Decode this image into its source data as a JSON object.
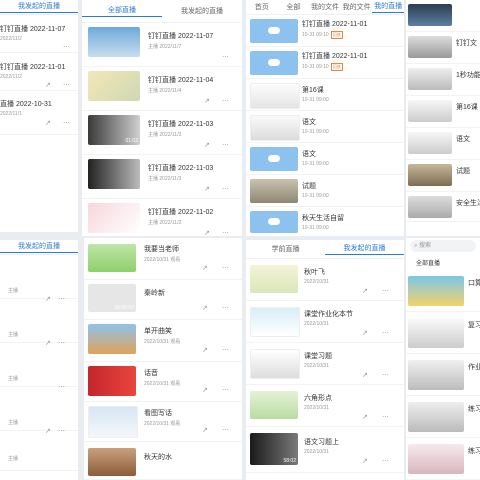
{
  "p1": {
    "tabs": [
      "我发起的直播"
    ],
    "items": [
      {
        "title": "钉钉直播 2022-11-07",
        "date": "2022/11/2"
      },
      {
        "title": "钉钉直播 2022-11-01",
        "date": "2022/11/2"
      },
      {
        "title": "直播 2022-10-31",
        "date": "2022/11/1"
      }
    ],
    "tabs2": [
      "我发起的直播"
    ],
    "items2": [
      {
        "sub": "主播"
      },
      {
        "sub": "主播"
      },
      {
        "sub": "主播"
      },
      {
        "sub": "主播"
      },
      {
        "sub": "主播"
      }
    ]
  },
  "p2": {
    "tabs": [
      "全部直播",
      "我发起的直播"
    ],
    "items": [
      {
        "title": "钉钉直播 2022-11-07",
        "sub": "主播  2022/11/7"
      },
      {
        "title": "钉钉直播 2022-11-04",
        "sub": "主播  2022/11/4"
      },
      {
        "title": "钉钉直播 2022-11-03",
        "sub": "主播  2022/11/3",
        "dur": "01:02"
      },
      {
        "title": "钉钉直播 2022-11-03",
        "sub": "主播  2022/11/3"
      },
      {
        "title": "钉钉直播 2022-11-02",
        "sub": "主播  2022/11/2"
      }
    ],
    "items2": [
      {
        "title": "我要当老师",
        "sub": "2022/10/31  观看"
      },
      {
        "title": "秦岭新",
        "sub": "",
        "dur": "05:00:02"
      },
      {
        "title": "单开曲笑",
        "sub": "2022/10/31  观看"
      },
      {
        "title": "话音",
        "sub": "2022/10/31  观看"
      },
      {
        "title": "看图写话",
        "sub": "2022/10/31  观看"
      },
      {
        "title": "秋天的水",
        "sub": ""
      }
    ]
  },
  "p3": {
    "tabs": [
      "首页",
      "全部",
      "我的文件",
      "我的文件",
      "我的直播"
    ],
    "items": [
      {
        "title": "钉钉直播 2022-11-01",
        "sub": "10-31 09:10",
        "tag": "回放"
      },
      {
        "title": "钉钉直播 2022-11-01",
        "sub": "10-31 09:10",
        "tag": "回放"
      },
      {
        "title": "第16课",
        "sub": "10-31 09:00"
      },
      {
        "title": "语文",
        "sub": "10-31 09:00"
      },
      {
        "title": "语文",
        "sub": "10-31 09:00"
      },
      {
        "title": "试题",
        "sub": "10-31 09:00"
      },
      {
        "title": "秋天生活自留",
        "sub": "10-31 09:00"
      }
    ],
    "tabs2": [
      "学前直播",
      "我发起的直播"
    ],
    "items2": [
      {
        "title": "秋叶飞",
        "sub": "2022/10/31"
      },
      {
        "title": "课堂作业化本节",
        "sub": "2022/10/31"
      },
      {
        "title": "课堂习题",
        "sub": "2022/10/31"
      },
      {
        "title": "六角形点",
        "sub": "2022/10/31"
      },
      {
        "title": "语文习题上",
        "sub": "2022/10/31",
        "dur": "58:02"
      }
    ]
  },
  "p4": {
    "items": [
      {
        "title": ""
      },
      {
        "title": "钉钉文",
        "sub": ""
      },
      {
        "title": "1秒功能",
        "sub": ""
      },
      {
        "title": "第16课",
        "sub": ""
      },
      {
        "title": "语文",
        "sub": ""
      },
      {
        "title": "试题",
        "sub": ""
      },
      {
        "title": "安全生活",
        "sub": ""
      }
    ],
    "search": "搜索",
    "tab": "全部直播",
    "items2": [
      {
        "title": "口算",
        "sub": ""
      },
      {
        "title": "复习",
        "sub": ""
      },
      {
        "title": "作业",
        "sub": ""
      },
      {
        "title": "练习",
        "sub": ""
      },
      {
        "title": "练习",
        "sub": ""
      }
    ]
  },
  "icons": {
    "share": "↗",
    "more": "⋯"
  }
}
